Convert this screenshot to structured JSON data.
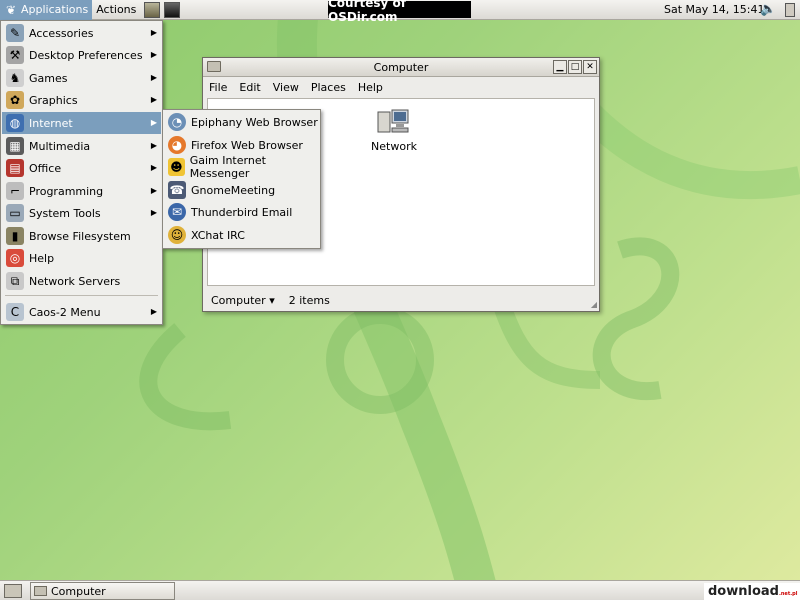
{
  "top_panel": {
    "applications_label": "Applications",
    "actions_label": "Actions",
    "banner": "Courtesy of OSDir.com",
    "clock": "Sat May 14, 15:41"
  },
  "app_menu": {
    "items": [
      {
        "label": "Accessories",
        "icon": "accessories-icon",
        "submenu": true
      },
      {
        "label": "Desktop Preferences",
        "icon": "preferences-icon",
        "submenu": true
      },
      {
        "label": "Games",
        "icon": "joystick-icon",
        "submenu": true
      },
      {
        "label": "Graphics",
        "icon": "graphics-icon",
        "submenu": true
      },
      {
        "label": "Internet",
        "icon": "globe-icon",
        "submenu": true,
        "selected": true
      },
      {
        "label": "Multimedia",
        "icon": "multimedia-icon",
        "submenu": true
      },
      {
        "label": "Office",
        "icon": "office-icon",
        "submenu": true
      },
      {
        "label": "Programming",
        "icon": "programming-icon",
        "submenu": true
      },
      {
        "label": "System Tools",
        "icon": "system-tools-icon",
        "submenu": true
      },
      {
        "label": "Browse Filesystem",
        "icon": "filesystem-icon",
        "submenu": false
      },
      {
        "label": "Help",
        "icon": "lifebuoy-icon",
        "submenu": false
      },
      {
        "label": "Network Servers",
        "icon": "network-servers-icon",
        "submenu": false
      },
      {
        "label": "Caos-2 Menu",
        "icon": "caos-icon",
        "submenu": true
      }
    ]
  },
  "internet_menu": {
    "items": [
      {
        "label": "Epiphany Web Browser",
        "icon": "epiphany-icon"
      },
      {
        "label": "Firefox Web Browser",
        "icon": "firefox-icon"
      },
      {
        "label": "Gaim Internet Messenger",
        "icon": "gaim-icon"
      },
      {
        "label": "GnomeMeeting",
        "icon": "gnomemeeting-icon"
      },
      {
        "label": "Thunderbird Email",
        "icon": "thunderbird-icon"
      },
      {
        "label": "XChat IRC",
        "icon": "xchat-icon"
      }
    ]
  },
  "window": {
    "title": "Computer",
    "menu": [
      "File",
      "Edit",
      "View",
      "Places",
      "Help"
    ],
    "items": [
      {
        "label": "Network",
        "icon": "network-icon"
      }
    ],
    "status_location": "Computer",
    "status_count": "2 items"
  },
  "taskbar": {
    "tasks": [
      {
        "label": "Computer"
      }
    ]
  },
  "watermark": {
    "text": "download",
    "suffix": ".net.pl"
  },
  "colors": {
    "highlight": "#7b9ebd",
    "desktop": "#9fd27b"
  }
}
